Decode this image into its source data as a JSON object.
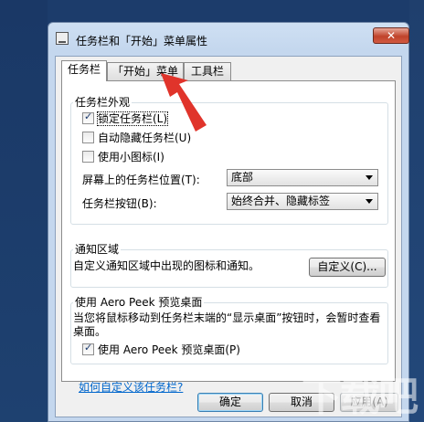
{
  "window": {
    "title": "任务栏和「开始」菜单属性",
    "close_label": "✕"
  },
  "tabs": [
    {
      "label": "任务栏",
      "active": true
    },
    {
      "label": "「开始」菜单",
      "active": false
    },
    {
      "label": "工具栏",
      "active": false
    }
  ],
  "appearance": {
    "title": "任务栏外观",
    "lock_taskbar": {
      "label": "锁定任务栏(L)",
      "checked": true
    },
    "auto_hide": {
      "label": "自动隐藏任务栏(U)",
      "checked": false
    },
    "small_icons": {
      "label": "使用小图标(I)",
      "checked": false
    },
    "position_label": "屏幕上的任务栏位置(T):",
    "position_value": "底部",
    "buttons_label": "任务栏按钮(B):",
    "buttons_value": "始终合并、隐藏标签"
  },
  "notification": {
    "title": "通知区域",
    "description": "自定义通知区域中出现的图标和通知。",
    "customize_button": "自定义(C)..."
  },
  "aero_peek": {
    "title": "使用 Aero Peek 预览桌面",
    "description": "当您将鼠标移动到任务栏末端的“显示桌面”按钮时，会暂时查看桌面。",
    "checkbox": {
      "label": "使用 Aero Peek 预览桌面(P)",
      "checked": true
    }
  },
  "help_link": "如何自定义该任务栏?",
  "footer": {
    "ok": "确定",
    "cancel": "取消",
    "apply": "应用(A)"
  },
  "watermark": "下载吧",
  "colors": {
    "desktop": "#1c3c6b",
    "annotation_arrow": "#e0342b",
    "link": "#0066cc"
  }
}
